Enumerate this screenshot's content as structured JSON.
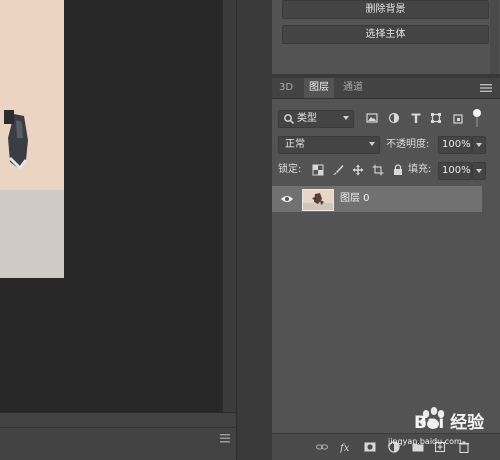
{
  "properties": {
    "remove_bg_label": "删除背景",
    "select_subject_label": "选择主体"
  },
  "layers_panel": {
    "tabs": [
      {
        "label": "3D",
        "active": false
      },
      {
        "label": "图层",
        "active": true
      },
      {
        "label": "通道",
        "active": false
      }
    ],
    "filter": {
      "kind_label": "类型",
      "icons": [
        "image-filter-icon",
        "adjustment-filter-icon",
        "type-filter-icon",
        "shape-filter-icon",
        "smart-object-filter-icon"
      ]
    },
    "blend_mode": "正常",
    "opacity_label": "不透明度:",
    "opacity_value": "100%",
    "lock_label": "锁定:",
    "lock_icons": [
      "lock-transparent-icon",
      "lock-paint-icon",
      "lock-position-icon",
      "lock-artboard-icon",
      "lock-all-icon"
    ],
    "fill_label": "填充:",
    "fill_value": "100%",
    "layers": [
      {
        "name": "图层 0",
        "visible": true,
        "selected": true
      }
    ],
    "footer_icons": [
      "link-icon",
      "fx-icon",
      "mask-icon",
      "adjustment-icon",
      "group-icon",
      "new-layer-icon",
      "delete-icon"
    ]
  },
  "watermark": {
    "brand": "Bai 经验",
    "url": "jingyan.baidu.com"
  },
  "colors": {
    "panel_bg": "#535353",
    "selected_row": "#717171",
    "canvas_bg": "#282828"
  }
}
